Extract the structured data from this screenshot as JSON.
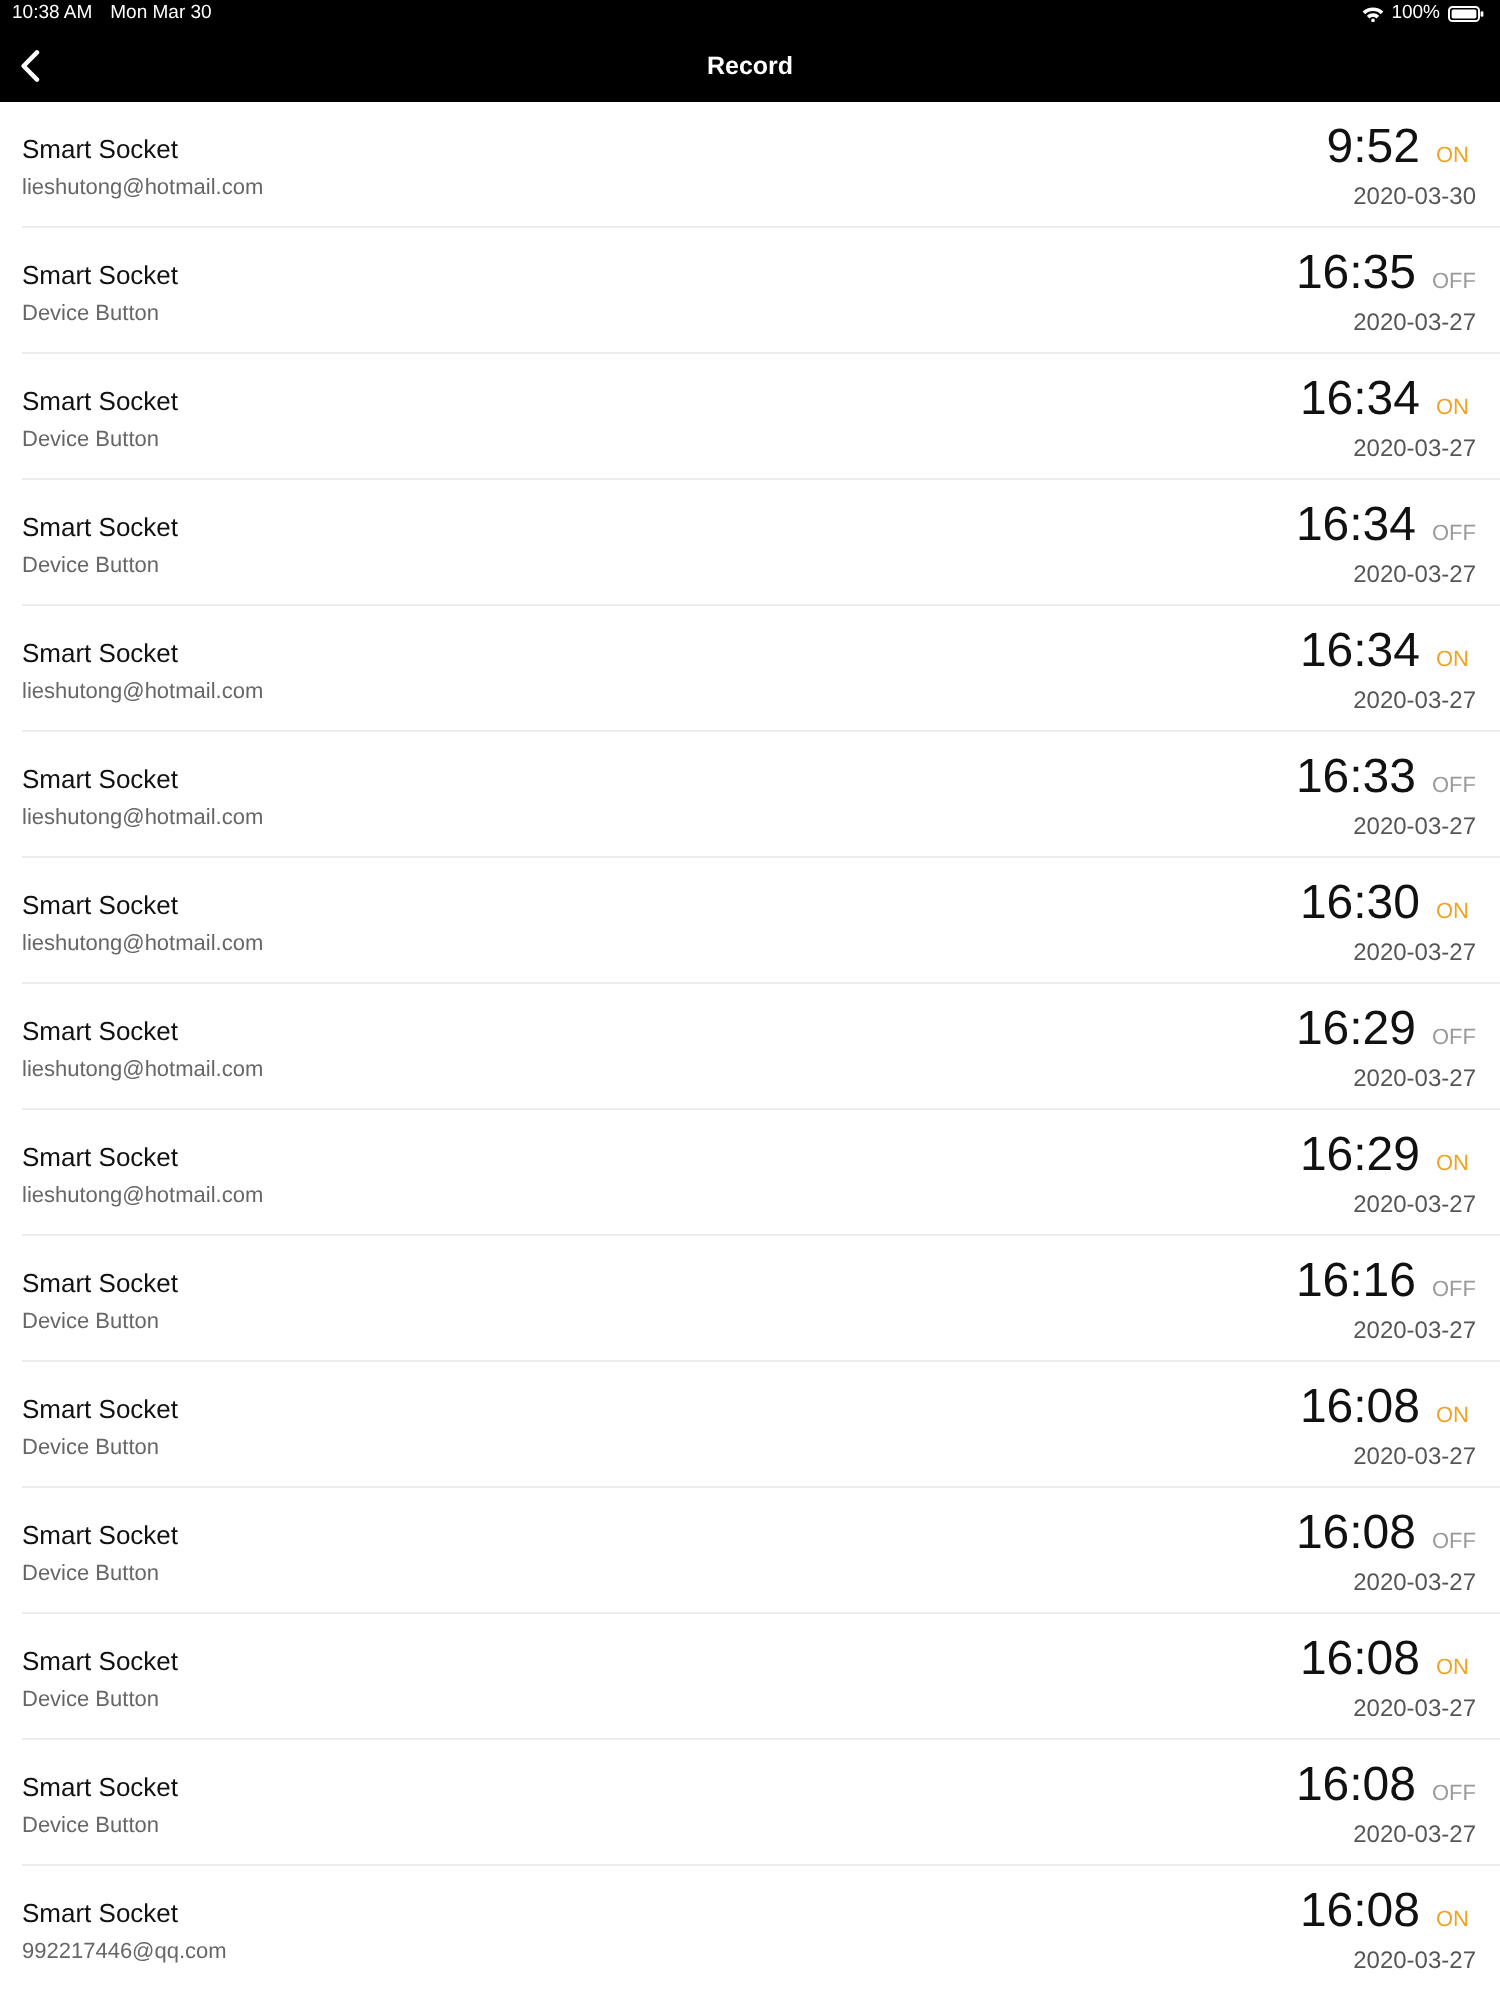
{
  "status_bar": {
    "time": "10:38 AM",
    "date": "Mon Mar 30",
    "battery": "100%"
  },
  "nav_bar": {
    "title": "Record"
  },
  "records": [
    {
      "device": "Smart Socket",
      "source": "lieshutong@hotmail.com",
      "time": "9:52",
      "state": "ON",
      "on": true,
      "date": "2020-03-30"
    },
    {
      "device": "Smart Socket",
      "source": "Device Button",
      "time": "16:35",
      "state": "OFF",
      "on": false,
      "date": "2020-03-27"
    },
    {
      "device": "Smart Socket",
      "source": "Device Button",
      "time": "16:34",
      "state": "ON",
      "on": true,
      "date": "2020-03-27"
    },
    {
      "device": "Smart Socket",
      "source": "Device Button",
      "time": "16:34",
      "state": "OFF",
      "on": false,
      "date": "2020-03-27"
    },
    {
      "device": "Smart Socket",
      "source": "lieshutong@hotmail.com",
      "time": "16:34",
      "state": "ON",
      "on": true,
      "date": "2020-03-27"
    },
    {
      "device": "Smart Socket",
      "source": "lieshutong@hotmail.com",
      "time": "16:33",
      "state": "OFF",
      "on": false,
      "date": "2020-03-27"
    },
    {
      "device": "Smart Socket",
      "source": "lieshutong@hotmail.com",
      "time": "16:30",
      "state": "ON",
      "on": true,
      "date": "2020-03-27"
    },
    {
      "device": "Smart Socket",
      "source": "lieshutong@hotmail.com",
      "time": "16:29",
      "state": "OFF",
      "on": false,
      "date": "2020-03-27"
    },
    {
      "device": "Smart Socket",
      "source": "lieshutong@hotmail.com",
      "time": "16:29",
      "state": "ON",
      "on": true,
      "date": "2020-03-27"
    },
    {
      "device": "Smart Socket",
      "source": "Device Button",
      "time": "16:16",
      "state": "OFF",
      "on": false,
      "date": "2020-03-27"
    },
    {
      "device": "Smart Socket",
      "source": "Device Button",
      "time": "16:08",
      "state": "ON",
      "on": true,
      "date": "2020-03-27"
    },
    {
      "device": "Smart Socket",
      "source": "Device Button",
      "time": "16:08",
      "state": "OFF",
      "on": false,
      "date": "2020-03-27"
    },
    {
      "device": "Smart Socket",
      "source": "Device Button",
      "time": "16:08",
      "state": "ON",
      "on": true,
      "date": "2020-03-27"
    },
    {
      "device": "Smart Socket",
      "source": "Device Button",
      "time": "16:08",
      "state": "OFF",
      "on": false,
      "date": "2020-03-27"
    },
    {
      "device": "Smart Socket",
      "source": "992217446@qq.com",
      "time": "16:08",
      "state": "ON",
      "on": true,
      "date": "2020-03-27"
    }
  ]
}
